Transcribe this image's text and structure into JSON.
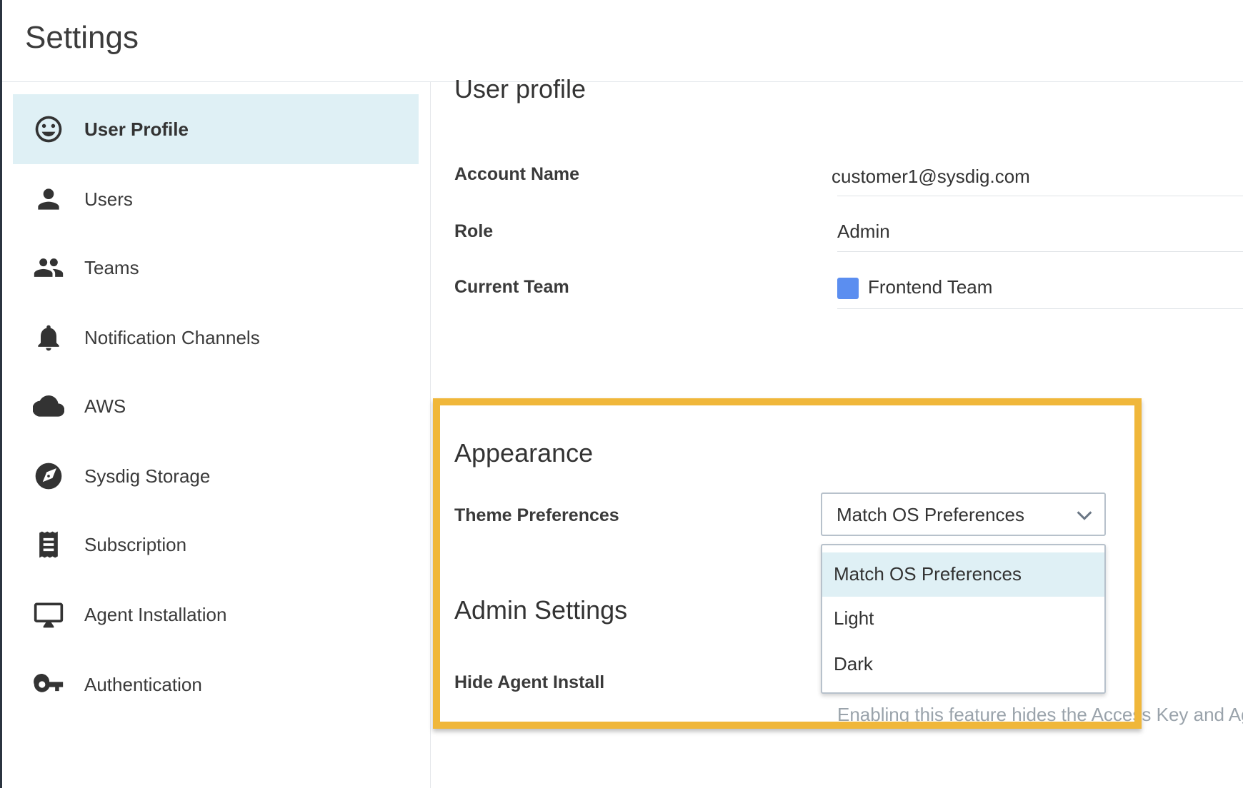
{
  "header": {
    "title": "Settings"
  },
  "sidebar": {
    "items": [
      {
        "label": "User Profile",
        "icon": "smiley-icon",
        "active": true
      },
      {
        "label": "Users",
        "icon": "person-icon"
      },
      {
        "label": "Teams",
        "icon": "group-icon"
      },
      {
        "label": "Notification Channels",
        "icon": "bell-icon"
      },
      {
        "label": "AWS",
        "icon": "cloud-icon"
      },
      {
        "label": "Sysdig Storage",
        "icon": "storage-icon"
      },
      {
        "label": "Subscription",
        "icon": "receipt-icon"
      },
      {
        "label": "Agent Installation",
        "icon": "monitor-icon"
      },
      {
        "label": "Authentication",
        "icon": "key-icon"
      }
    ]
  },
  "main": {
    "profile_title": "User profile",
    "fields": {
      "account_name": {
        "label": "Account Name",
        "value": "customer1@sysdig.com"
      },
      "role": {
        "label": "Role",
        "value": "Admin"
      },
      "current_team": {
        "label": "Current Team",
        "value": "Frontend Team",
        "swatch_color": "#5b8ef0"
      }
    },
    "appearance": {
      "title": "Appearance",
      "theme_label": "Theme Preferences",
      "theme_selected": "Match OS Preferences",
      "options": [
        "Match OS Preferences",
        "Light",
        "Dark"
      ]
    },
    "admin": {
      "title": "Admin Settings",
      "hide_agent_label": "Hide Agent Install",
      "help_text": "Enabling this feature hides the Access Key and Age"
    }
  },
  "colors": {
    "highlight": "#f0b73a",
    "active_bg": "#dff0f5",
    "accent": "#5b8ef0"
  }
}
